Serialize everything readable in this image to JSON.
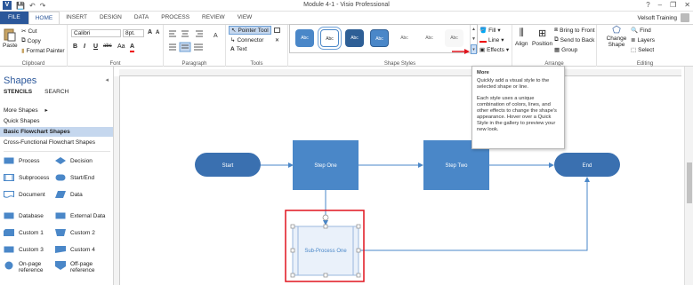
{
  "window": {
    "title": "Module 4-1 - Visio Professional",
    "app_icon": "V"
  },
  "quick_access": [
    "save-icon",
    "undo-icon",
    "redo-icon"
  ],
  "window_controls": {
    "help": "?",
    "minimize": "–",
    "restore": "❐",
    "close": "✕"
  },
  "tabs": [
    {
      "label": "FILE"
    },
    {
      "label": "HOME"
    },
    {
      "label": "INSERT"
    },
    {
      "label": "DESIGN"
    },
    {
      "label": "DATA"
    },
    {
      "label": "PROCESS"
    },
    {
      "label": "REVIEW"
    },
    {
      "label": "VIEW"
    }
  ],
  "user": {
    "name": "Velsoft Training"
  },
  "ribbon": {
    "clipboard": {
      "paste": "Paste",
      "cut": "Cut",
      "copy": "Copy",
      "format_painter": "Format Painter",
      "label": "Clipboard"
    },
    "font": {
      "name": "Calibri",
      "size": "8pt.",
      "bold": "B",
      "italic": "I",
      "underline": "U",
      "strike": "abc",
      "grow": "A",
      "shrink": "A",
      "case": "Aa",
      "color": "A",
      "label": "Font"
    },
    "paragraph": {
      "label": "Paragraph"
    },
    "tools": {
      "pointer": "Pointer Tool",
      "connector": "Connector",
      "text": "Text",
      "label": "Tools"
    },
    "shape_styles": {
      "swatches": [
        "Abc",
        "Abc",
        "Abc",
        "Abc",
        "Abc",
        "Abc",
        "Abc"
      ],
      "label": "Shape Styles"
    },
    "format": {
      "fill": "Fill",
      "line": "Line",
      "effects": "Effects"
    },
    "arrange": {
      "align": "Align",
      "position": "Position",
      "bring_front": "Bring to Front",
      "send_back": "Send to Back",
      "group": "Group",
      "label": "Arrange"
    },
    "editing": {
      "change_shape": "Change Shape",
      "find": "Find",
      "layers": "Layers",
      "select": "Select",
      "label": "Editing"
    }
  },
  "tooltip": {
    "title": "More",
    "line1": "Quickly add a visual style to the selected shape or line.",
    "line2": "Each style uses a unique combination of colors, lines, and other effects to change the shape's appearance. Hover over a Quick Style in the gallery to preview your new look."
  },
  "shapes_panel": {
    "title": "Shapes",
    "tabs": [
      "STENCILS",
      "SEARCH"
    ],
    "items": [
      "More Shapes",
      "Quick Shapes",
      "Basic Flowchart Shapes",
      "Cross-Functional Flowchart Shapes"
    ],
    "shapes": [
      {
        "label": "Process"
      },
      {
        "label": "Decision"
      },
      {
        "label": "Subprocess"
      },
      {
        "label": "Start/End"
      },
      {
        "label": "Document"
      },
      {
        "label": "Data"
      },
      {
        "label": "Database"
      },
      {
        "label": "External Data"
      },
      {
        "label": "Custom 1"
      },
      {
        "label": "Custom 2"
      },
      {
        "label": "Custom 3"
      },
      {
        "label": "Custom 4"
      },
      {
        "label": "On-page reference"
      },
      {
        "label": "Off-page reference"
      }
    ]
  },
  "diagram": {
    "shapes": [
      {
        "label": "Start"
      },
      {
        "label": "Step One"
      },
      {
        "label": "Step Two"
      },
      {
        "label": "End"
      },
      {
        "label": "Sub-Process One"
      }
    ]
  },
  "colors": {
    "accent": "#2b579a",
    "shape_fill": "#4a87c8",
    "terminator_fill": "#3a70b0",
    "selection_red": "#e0141e"
  }
}
